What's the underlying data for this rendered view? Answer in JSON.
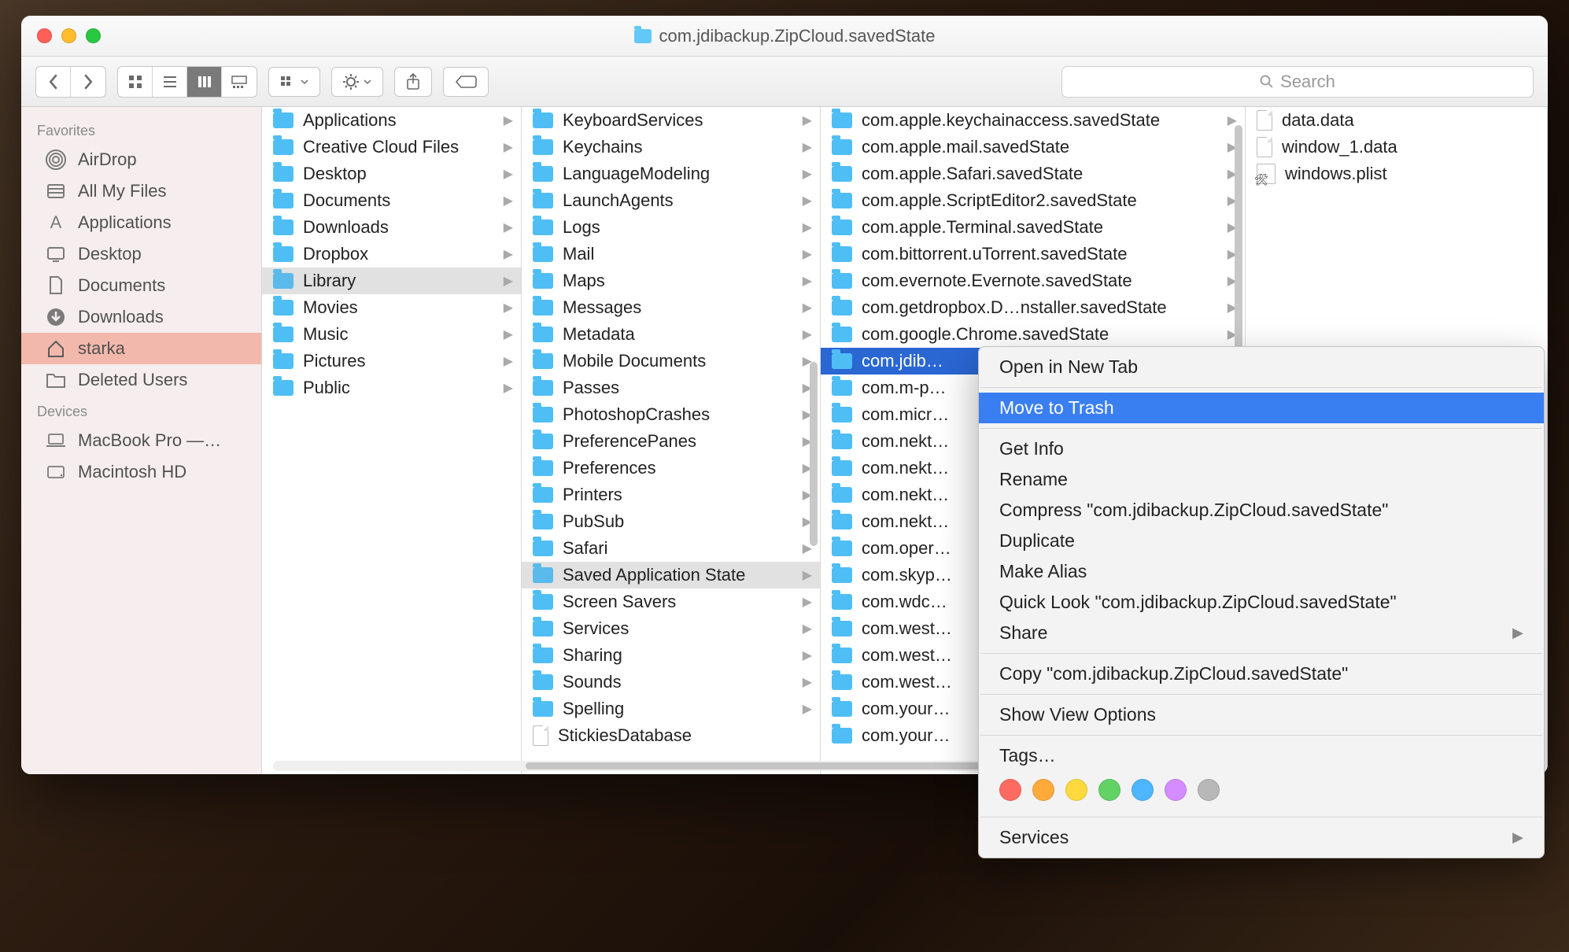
{
  "window_title": "com.jdibackup.ZipCloud.savedState",
  "search_placeholder": "Search",
  "sidebar": {
    "groups": [
      {
        "label": "Favorites",
        "items": [
          {
            "icon": "airdrop",
            "label": "AirDrop"
          },
          {
            "icon": "allfiles",
            "label": "All My Files"
          },
          {
            "icon": "apps",
            "label": "Applications"
          },
          {
            "icon": "desktop",
            "label": "Desktop"
          },
          {
            "icon": "docs",
            "label": "Documents"
          },
          {
            "icon": "downloads",
            "label": "Downloads"
          },
          {
            "icon": "home",
            "label": "starka",
            "selected": true
          },
          {
            "icon": "folder",
            "label": "Deleted Users"
          }
        ]
      },
      {
        "label": "Devices",
        "items": [
          {
            "icon": "laptop",
            "label": "MacBook Pro —…"
          },
          {
            "icon": "hd",
            "label": "Macintosh HD"
          }
        ]
      }
    ]
  },
  "columns": [
    {
      "items": [
        {
          "t": "folder",
          "label": "Applications",
          "chev": true
        },
        {
          "t": "folder",
          "label": "Creative Cloud Files",
          "chev": true
        },
        {
          "t": "folder",
          "label": "Desktop",
          "chev": true
        },
        {
          "t": "folder",
          "label": "Documents",
          "chev": true
        },
        {
          "t": "folder",
          "label": "Downloads",
          "chev": true
        },
        {
          "t": "folder",
          "label": "Dropbox",
          "chev": true
        },
        {
          "t": "folder",
          "label": "Library",
          "chev": true,
          "sel": "light"
        },
        {
          "t": "folder",
          "label": "Movies",
          "chev": true
        },
        {
          "t": "folder",
          "label": "Music",
          "chev": true
        },
        {
          "t": "folder",
          "label": "Pictures",
          "chev": true
        },
        {
          "t": "folder",
          "label": "Public",
          "chev": true
        }
      ]
    },
    {
      "items": [
        {
          "t": "folder",
          "label": "KeyboardServices",
          "chev": true
        },
        {
          "t": "folder",
          "label": "Keychains",
          "chev": true
        },
        {
          "t": "folder",
          "label": "LanguageModeling",
          "chev": true
        },
        {
          "t": "folder",
          "label": "LaunchAgents",
          "chev": true
        },
        {
          "t": "folder",
          "label": "Logs",
          "chev": true
        },
        {
          "t": "folder",
          "label": "Mail",
          "chev": true
        },
        {
          "t": "folder",
          "label": "Maps",
          "chev": true
        },
        {
          "t": "folder",
          "label": "Messages",
          "chev": true
        },
        {
          "t": "folder",
          "label": "Metadata",
          "chev": true
        },
        {
          "t": "folder",
          "label": "Mobile Documents",
          "chev": true
        },
        {
          "t": "folder",
          "label": "Passes",
          "chev": true
        },
        {
          "t": "folder",
          "label": "PhotoshopCrashes",
          "chev": true
        },
        {
          "t": "folder",
          "label": "PreferencePanes",
          "chev": true
        },
        {
          "t": "folder",
          "label": "Preferences",
          "chev": true
        },
        {
          "t": "folder",
          "label": "Printers",
          "chev": true
        },
        {
          "t": "folder",
          "label": "PubSub",
          "chev": true
        },
        {
          "t": "folder",
          "label": "Safari",
          "chev": true
        },
        {
          "t": "folder",
          "label": "Saved Application State",
          "chev": true,
          "sel": "light"
        },
        {
          "t": "folder",
          "label": "Screen Savers",
          "chev": true
        },
        {
          "t": "folder",
          "label": "Services",
          "chev": true
        },
        {
          "t": "folder",
          "label": "Sharing",
          "chev": true
        },
        {
          "t": "folder",
          "label": "Sounds",
          "chev": true
        },
        {
          "t": "folder",
          "label": "Spelling",
          "chev": true
        },
        {
          "t": "file",
          "label": "StickiesDatabase"
        }
      ],
      "scroll": {
        "top": "38%",
        "height": "28%"
      }
    },
    {
      "items": [
        {
          "t": "folder",
          "label": "com.apple.keychainaccess.savedState",
          "chev": true
        },
        {
          "t": "folder",
          "label": "com.apple.mail.savedState",
          "chev": true
        },
        {
          "t": "folder",
          "label": "com.apple.Safari.savedState",
          "chev": true
        },
        {
          "t": "folder",
          "label": "com.apple.ScriptEditor2.savedState",
          "chev": true
        },
        {
          "t": "folder",
          "label": "com.apple.Terminal.savedState",
          "chev": true
        },
        {
          "t": "folder",
          "label": "com.bittorrent.uTorrent.savedState",
          "chev": true
        },
        {
          "t": "folder",
          "label": "com.evernote.Evernote.savedState",
          "chev": true
        },
        {
          "t": "folder",
          "label": "com.getdropbox.D…nstaller.savedState",
          "chev": true
        },
        {
          "t": "folder",
          "label": "com.google.Chrome.savedState",
          "chev": true
        },
        {
          "t": "folder",
          "label": "com.jdib…",
          "chev": true,
          "sel": "blue"
        },
        {
          "t": "folder",
          "label": "com.m-p…"
        },
        {
          "t": "folder",
          "label": "com.micr…"
        },
        {
          "t": "folder",
          "label": "com.nekt…"
        },
        {
          "t": "folder",
          "label": "com.nekt…"
        },
        {
          "t": "folder",
          "label": "com.nekt…"
        },
        {
          "t": "folder",
          "label": "com.nekt…"
        },
        {
          "t": "folder",
          "label": "com.oper…"
        },
        {
          "t": "folder",
          "label": "com.skyp…"
        },
        {
          "t": "folder",
          "label": "com.wdc…"
        },
        {
          "t": "folder",
          "label": "com.west…"
        },
        {
          "t": "folder",
          "label": "com.west…"
        },
        {
          "t": "folder",
          "label": "com.west…"
        },
        {
          "t": "folder",
          "label": "com.your…"
        },
        {
          "t": "folder",
          "label": "com.your…"
        }
      ],
      "scroll": {
        "top": "2%",
        "height": "36%"
      }
    },
    {
      "items": [
        {
          "t": "file",
          "label": "data.data"
        },
        {
          "t": "file",
          "label": "window_1.data"
        },
        {
          "t": "plist",
          "label": "windows.plist"
        }
      ]
    }
  ],
  "context_menu": {
    "groups": [
      [
        {
          "label": "Open in New Tab"
        }
      ],
      [
        {
          "label": "Move to Trash",
          "hl": true
        }
      ],
      [
        {
          "label": "Get Info"
        },
        {
          "label": "Rename"
        },
        {
          "label": "Compress \"com.jdibackup.ZipCloud.savedState\""
        },
        {
          "label": "Duplicate"
        },
        {
          "label": "Make Alias"
        },
        {
          "label": "Quick Look \"com.jdibackup.ZipCloud.savedState\""
        },
        {
          "label": "Share",
          "sub": true
        }
      ],
      [
        {
          "label": "Copy \"com.jdibackup.ZipCloud.savedState\""
        }
      ],
      [
        {
          "label": "Show View Options"
        }
      ],
      [
        {
          "label": "Tags…",
          "tags": true
        }
      ],
      [
        {
          "label": "Services",
          "sub": true
        }
      ]
    ]
  }
}
